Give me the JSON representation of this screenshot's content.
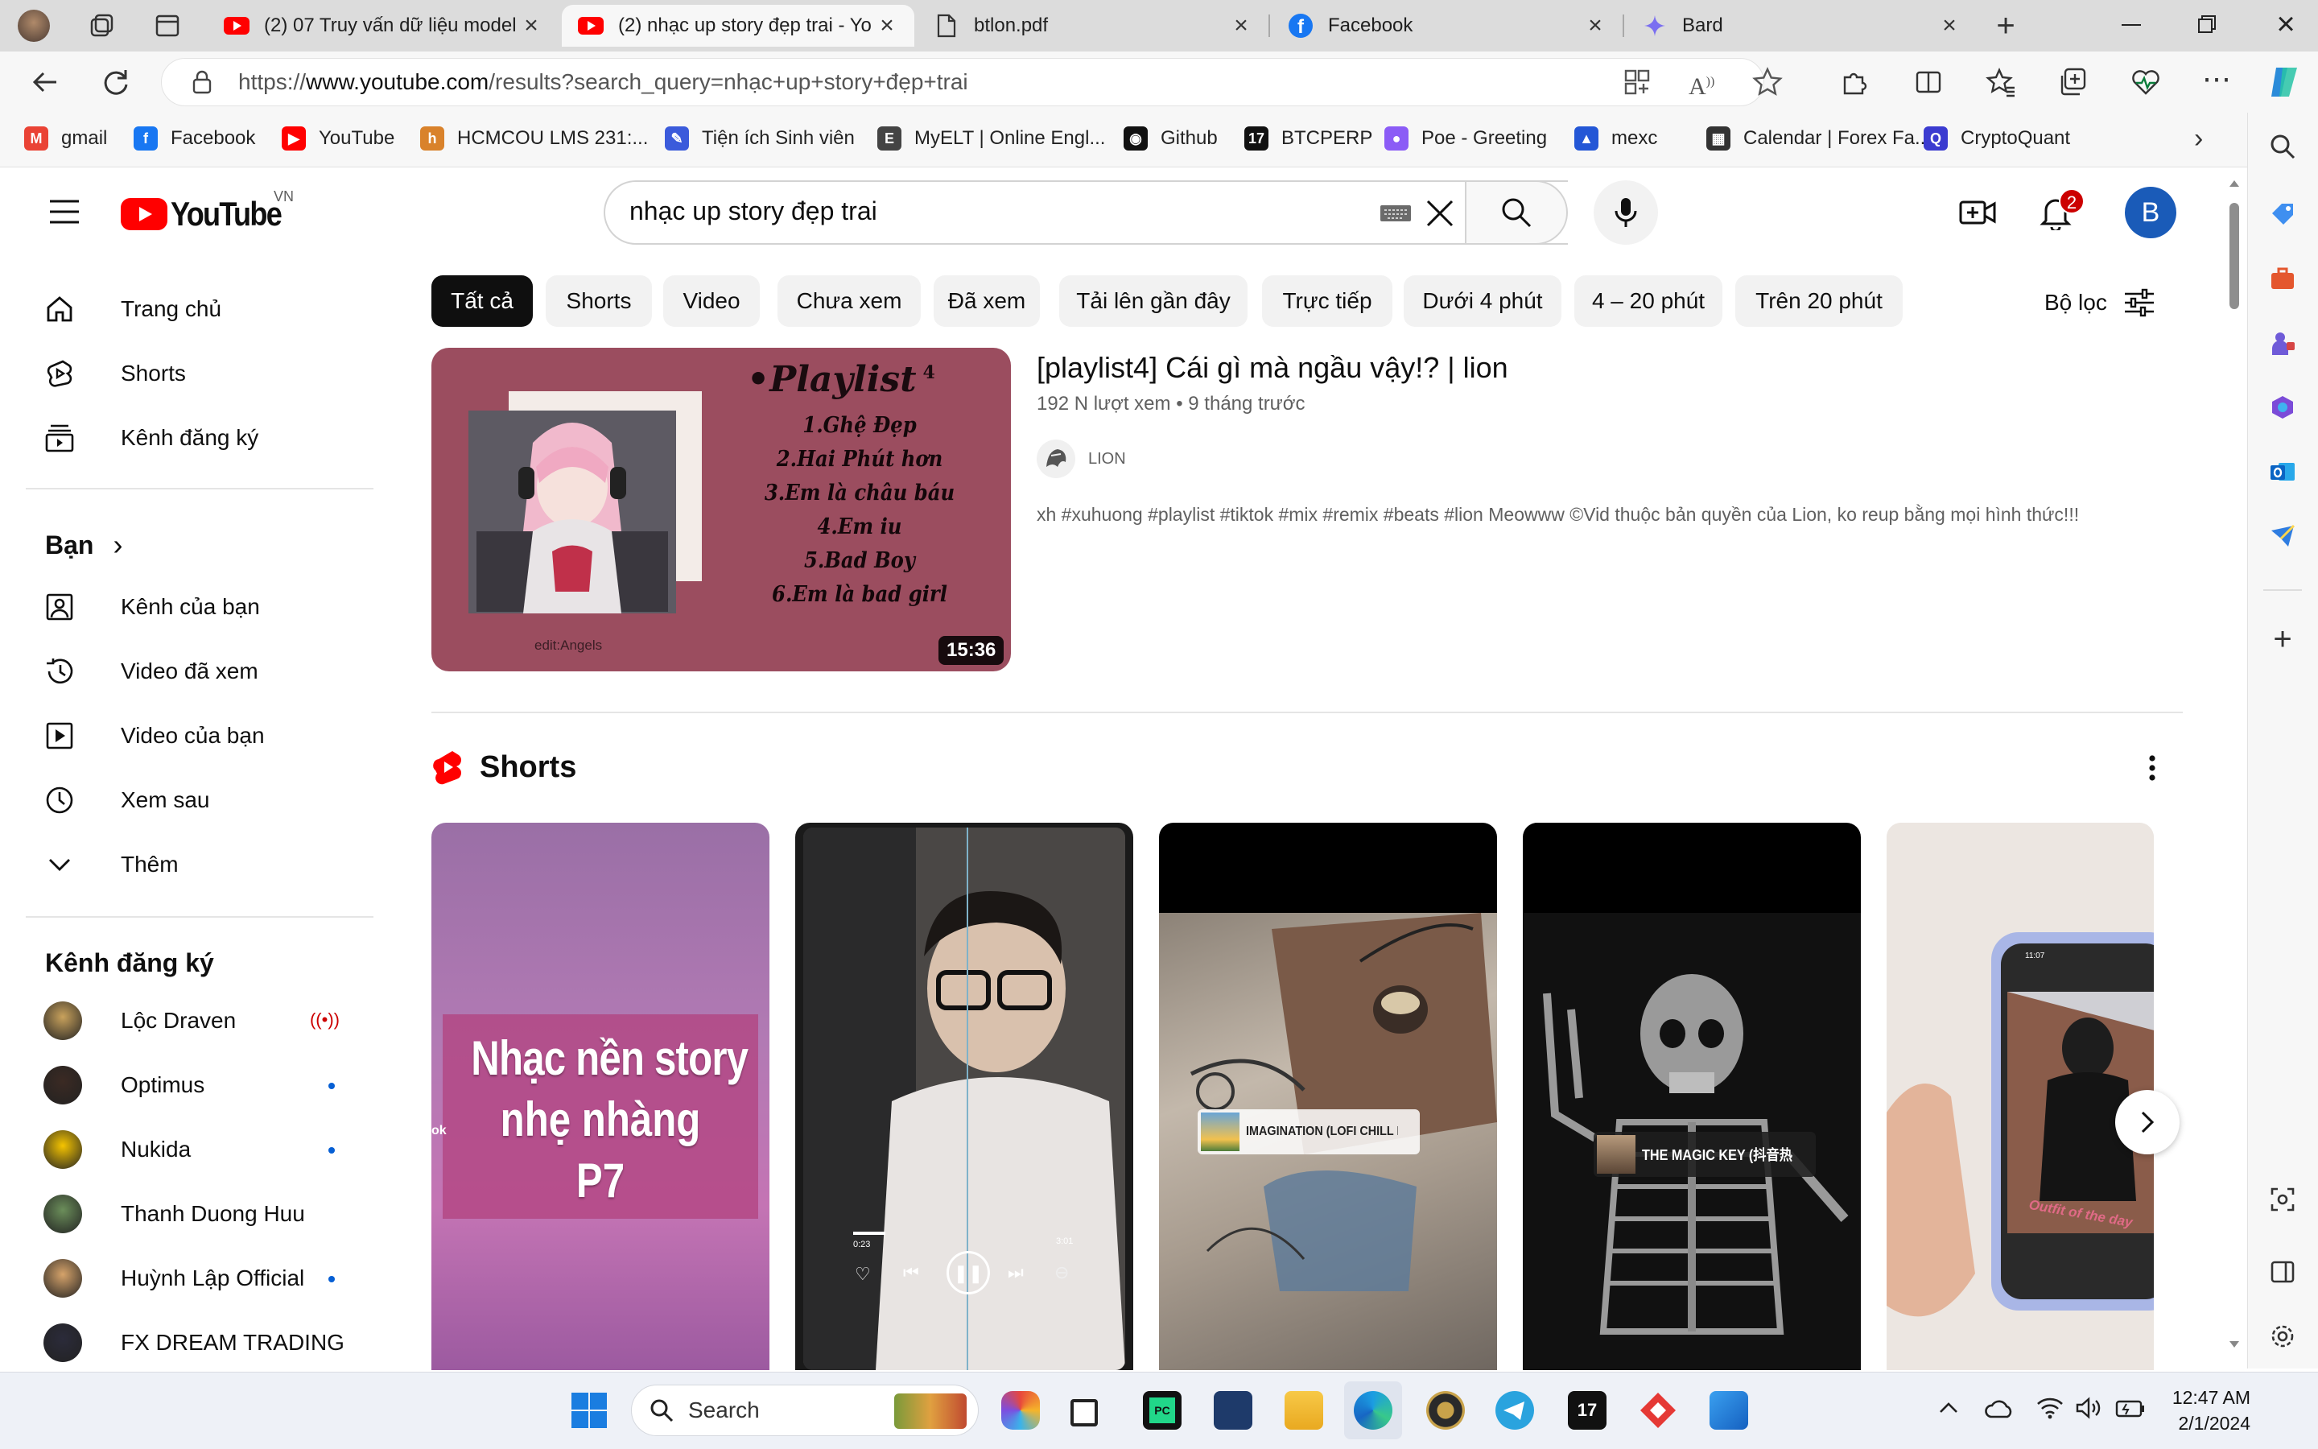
{
  "browser": {
    "tabs": [
      {
        "title": "(2) 07 Truy vấn dữ liệu model",
        "icon": "youtube-icon",
        "active": false
      },
      {
        "title": "(2) nhạc up story đẹp trai - Yo",
        "icon": "youtube-icon",
        "active": true
      },
      {
        "title": "btlon.pdf",
        "icon": "document-icon",
        "active": false
      },
      {
        "title": "Facebook",
        "icon": "facebook-icon",
        "active": false
      },
      {
        "title": "Bard",
        "icon": "bard-icon",
        "active": false
      }
    ],
    "url_prefix": "https://",
    "url_host": "www.youtube.com",
    "url_path": "/results?search_query=nhạc+up+story+đẹp+trai",
    "bookmarks": [
      {
        "label": "gmail",
        "color": "#ea4335",
        "glyph": "M"
      },
      {
        "label": "Facebook",
        "color": "#1877f2",
        "glyph": "f"
      },
      {
        "label": "YouTube",
        "color": "#ff0000",
        "glyph": "▶"
      },
      {
        "label": "HCMCOU LMS 231:...",
        "color": "#d9822b",
        "glyph": "h"
      },
      {
        "label": "Tiện ích Sinh viên",
        "color": "#3b5bdb",
        "glyph": "✎"
      },
      {
        "label": "MyELT | Online Engl...",
        "color": "#444444",
        "glyph": "E"
      },
      {
        "label": "Github",
        "color": "#111111",
        "glyph": "◉"
      },
      {
        "label": "BTCPERP",
        "color": "#111111",
        "glyph": "17"
      },
      {
        "label": "Poe - Greeting",
        "color": "#8b5cf6",
        "glyph": "●"
      },
      {
        "label": "mexc",
        "color": "#2457d6",
        "glyph": "▲"
      },
      {
        "label": "Calendar | Forex Fa...",
        "color": "#333333",
        "glyph": "▦"
      },
      {
        "label": "CryptoQuant",
        "color": "#3b3bd0",
        "glyph": "Q"
      }
    ]
  },
  "youtube": {
    "logo_text": "YouTube",
    "region": "VN",
    "search_value": "nhạc up story đẹp trai",
    "notification_count": "2",
    "avatar_letter": "B",
    "guide": {
      "main": [
        {
          "label": "Trang chủ",
          "icon": "home-icon"
        },
        {
          "label": "Shorts",
          "icon": "shorts-icon"
        },
        {
          "label": "Kênh đăng ký",
          "icon": "subscriptions-icon"
        }
      ],
      "you_title": "Bạn",
      "you": [
        {
          "label": "Kênh của bạn",
          "icon": "your-channel-icon"
        },
        {
          "label": "Video đã xem",
          "icon": "history-icon"
        },
        {
          "label": "Video của bạn",
          "icon": "your-videos-icon"
        },
        {
          "label": "Xem sau",
          "icon": "watch-later-icon"
        },
        {
          "label": "Thêm",
          "icon": "chevron-down-icon"
        }
      ],
      "subs_title": "Kênh đăng ký",
      "subs": [
        {
          "label": "Lộc Draven",
          "status": "live",
          "color": "#c9a25c"
        },
        {
          "label": "Optimus",
          "status": "new",
          "color": "#3b2a23"
        },
        {
          "label": "Nukida",
          "status": "new",
          "color": "#f5c400"
        },
        {
          "label": "Thanh Duong Huu",
          "status": "none",
          "color": "#6b8e5a"
        },
        {
          "label": "Huỳnh Lập Official",
          "status": "new",
          "color": "#d6a36a"
        },
        {
          "label": "FX DREAM TRADING",
          "status": "none",
          "color": "#2b2b3a"
        }
      ]
    },
    "chips": [
      "Tất cả",
      "Shorts",
      "Video",
      "Chưa xem",
      "Đã xem",
      "Tải lên gần đây",
      "Trực tiếp",
      "Dưới 4 phút",
      "4 – 20 phút",
      "Trên 20 phút"
    ],
    "filter_label": "Bộ lọc",
    "video": {
      "title": "[playlist4] Cái gì mà ngầu vậy!? | lion",
      "views": "192 N lượt xem",
      "age": "9 tháng trước",
      "channel": "LION",
      "description": "xh #xuhuong #playlist #tiktok #mix #remix #beats #lion Meowww ©Vid thuộc bản quyền của Lion, ko reup bằng mọi hình thức!!!",
      "duration": "15:36",
      "thumb_heading": "•Playlist",
      "thumb_sup": "4",
      "thumb_lines": [
        "1.Ghệ Đẹp",
        "2.Hai Phút hơn",
        "3.Em là châu báu",
        "4.Em iu",
        "5.Bad Boy",
        "6.Em là bad girl"
      ],
      "thumb_credit": "edit:Angels"
    },
    "shorts_title": "Shorts",
    "shorts": [
      {
        "overlay": [
          "Nhạc nền story",
          "nhẹ nhàng",
          "P7"
        ],
        "side_text": "ok"
      },
      {
        "time_left": "0:23",
        "time_right": "3:01"
      },
      {
        "song": "IMAGINATION (LOFI CHILL H"
      },
      {
        "song": "THE MAGIC KEY (抖音热"
      },
      {
        "caption": "Outfit of the day",
        "phone_time": "11:07"
      }
    ]
  },
  "taskbar": {
    "search_placeholder": "Search",
    "time": "12:47 AM",
    "date": "2/1/2024"
  }
}
